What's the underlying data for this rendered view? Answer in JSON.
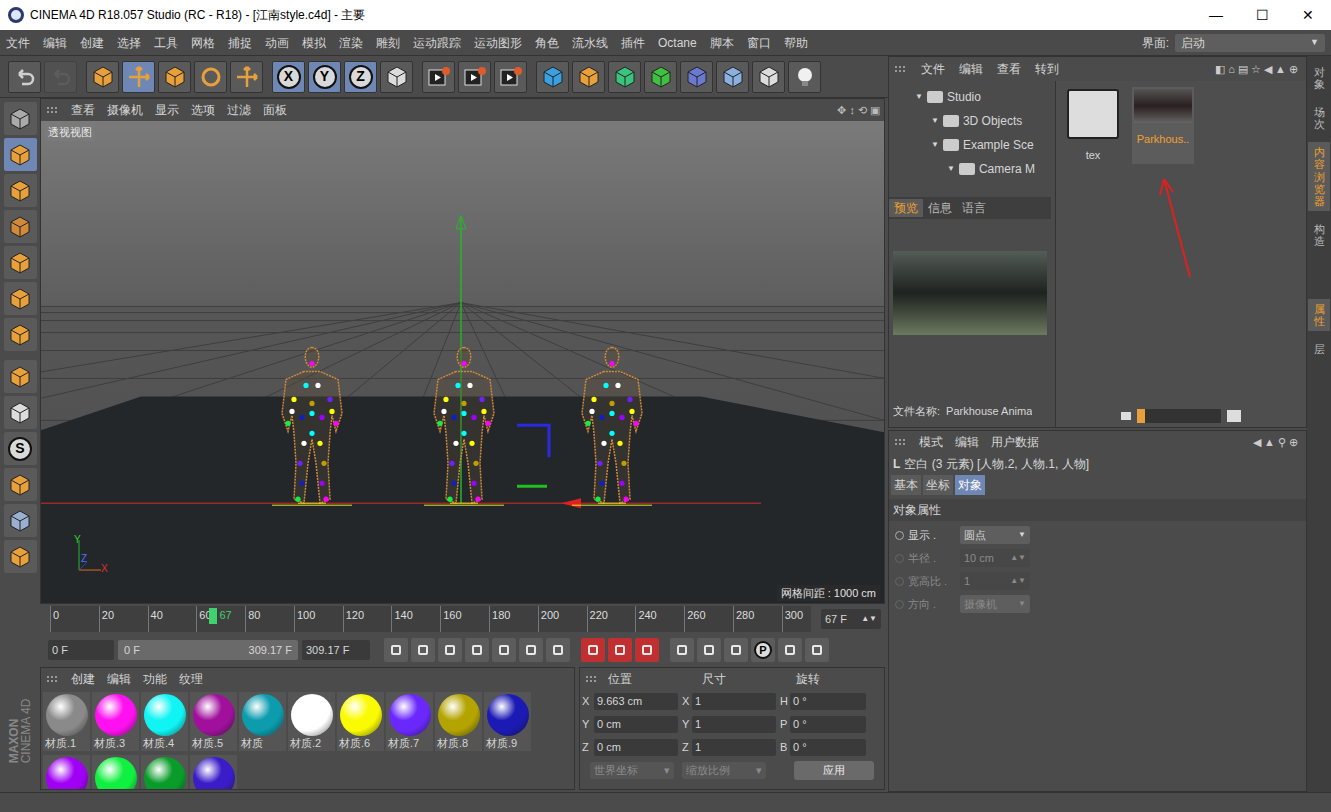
{
  "window": {
    "title": "CINEMA 4D R18.057 Studio (RC - R18) - [江南style.c4d] - 主要",
    "controls": [
      "—",
      "☐",
      "✕"
    ]
  },
  "menu": [
    "文件",
    "编辑",
    "创建",
    "选择",
    "工具",
    "网格",
    "捕捉",
    "动画",
    "模拟",
    "渲染",
    "雕刻",
    "运动跟踪",
    "运动图形",
    "角色",
    "流水线",
    "插件",
    "Octane",
    "脚本",
    "窗口",
    "帮助"
  ],
  "layout": {
    "label": "界面:",
    "value": "启动"
  },
  "toolbar": [
    {
      "kind": "undo",
      "selected": false,
      "disabled": false
    },
    {
      "kind": "redo",
      "selected": false,
      "disabled": true
    },
    {
      "kind": "select",
      "selected": false,
      "disabled": false
    },
    {
      "kind": "move",
      "selected": true,
      "disabled": false
    },
    {
      "kind": "scale",
      "selected": false,
      "disabled": false
    },
    {
      "kind": "rotate",
      "selected": false,
      "disabled": false
    },
    {
      "kind": "add",
      "selected": false,
      "disabled": false
    },
    {
      "kind": "axis",
      "label": "X",
      "selected": true,
      "disabled": false
    },
    {
      "kind": "axis",
      "label": "Y",
      "selected": true,
      "disabled": false
    },
    {
      "kind": "axis",
      "label": "Z",
      "selected": true,
      "disabled": false
    },
    {
      "kind": "coord",
      "selected": false,
      "disabled": false
    },
    {
      "kind": "render",
      "selected": false,
      "disabled": false
    },
    {
      "kind": "render",
      "selected": false,
      "disabled": false
    },
    {
      "kind": "render",
      "selected": false,
      "disabled": false
    },
    {
      "kind": "cube",
      "selected": false,
      "disabled": false
    },
    {
      "kind": "pen",
      "selected": false,
      "disabled": false
    },
    {
      "kind": "subdiv",
      "selected": false,
      "disabled": false
    },
    {
      "kind": "cloner",
      "selected": false,
      "disabled": false
    },
    {
      "kind": "deformer",
      "selected": false,
      "disabled": false
    },
    {
      "kind": "floor",
      "selected": false,
      "disabled": false
    },
    {
      "kind": "camera",
      "selected": false,
      "disabled": false
    },
    {
      "kind": "light",
      "selected": false,
      "disabled": false
    }
  ],
  "left_tools": [
    {
      "kind": "mode",
      "selected": false
    },
    {
      "kind": "model",
      "selected": true
    },
    {
      "kind": "texture",
      "selected": false
    },
    {
      "kind": "workplane",
      "selected": false
    },
    {
      "kind": "points",
      "selected": false
    },
    {
      "kind": "edges",
      "selected": false
    },
    {
      "kind": "polygons",
      "selected": false
    },
    {
      "kind": "axis",
      "selected": false
    },
    {
      "kind": "tweak",
      "selected": false
    },
    {
      "kind": "solo",
      "label": "S",
      "selected": false
    },
    {
      "kind": "magnet",
      "selected": false
    },
    {
      "kind": "lock",
      "selected": false
    },
    {
      "kind": "grid",
      "selected": false
    }
  ],
  "logo": {
    "brand": "MAXON",
    "product": "CINEMA 4D"
  },
  "viewport": {
    "menu": [
      "查看",
      "摄像机",
      "显示",
      "选项",
      "过滤",
      "面板"
    ],
    "label": "透视视图",
    "grid": "网格间距 : 1000 cm",
    "axes": [
      "Y",
      "Z",
      "X"
    ]
  },
  "timeline": {
    "ticks": [
      "0",
      "20",
      "40",
      "60",
      "80",
      "100",
      "120",
      "140",
      "160",
      "180",
      "200",
      "220",
      "240",
      "260",
      "280",
      "300"
    ],
    "current": "67",
    "end": 312,
    "field": "67 F"
  },
  "playback": {
    "start": "0 F",
    "range_start": "0 F",
    "range_end": "309.17 F",
    "end": "309.17 F",
    "buttons": [
      {
        "kind": "first"
      },
      {
        "kind": "prev-key"
      },
      {
        "kind": "prev"
      },
      {
        "kind": "play"
      },
      {
        "kind": "next"
      },
      {
        "kind": "next-key"
      },
      {
        "kind": "last"
      },
      {
        "kind": "record"
      },
      {
        "kind": "autokey"
      },
      {
        "kind": "help"
      },
      {
        "kind": "pos"
      },
      {
        "kind": "scl"
      },
      {
        "kind": "rot"
      },
      {
        "kind": "param",
        "label": "P"
      },
      {
        "kind": "pla"
      },
      {
        "kind": "film"
      }
    ]
  },
  "materials": {
    "menu": [
      "创建",
      "编辑",
      "功能",
      "纹理"
    ],
    "items": [
      {
        "name": "材质.1",
        "color": "#8a8a8a"
      },
      {
        "name": "材质.3",
        "color": "#ff10f0"
      },
      {
        "name": "材质.4",
        "color": "#10f4f4"
      },
      {
        "name": "材质.5",
        "color": "#a0109c"
      },
      {
        "name": "材质",
        "color": "#0c9cae"
      },
      {
        "name": "材质.2",
        "color": "#ffffff"
      },
      {
        "name": "材质.6",
        "color": "#fafa00"
      },
      {
        "name": "材质.7",
        "color": "#6a28ff"
      },
      {
        "name": "材质.8",
        "color": "#b4a400"
      },
      {
        "name": "材质.9",
        "color": "#1c1ab4"
      },
      {
        "name": "",
        "color": "#a000f4"
      },
      {
        "name": "",
        "color": "#10f040"
      },
      {
        "name": "",
        "color": "#0a9c2a"
      },
      {
        "name": "",
        "color": "#3a1cc8"
      }
    ]
  },
  "coordinates": {
    "headers": [
      "位置",
      "尺寸",
      "旋转"
    ],
    "rows": [
      {
        "axis": "X",
        "position": "9.663 cm",
        "size_axis": "X",
        "size": "1",
        "rot_axis": "H",
        "rotation": "0 °"
      },
      {
        "axis": "Y",
        "position": "0 cm",
        "size_axis": "Y",
        "size": "1",
        "rot_axis": "P",
        "rotation": "0 °"
      },
      {
        "axis": "Z",
        "position": "0 cm",
        "size_axis": "Z",
        "size": "1",
        "rot_axis": "B",
        "rotation": "0 °"
      }
    ],
    "mode": "世界坐标",
    "scale": "缩放比例",
    "apply": "应用"
  },
  "content_browser": {
    "menu": [
      "文件",
      "编辑",
      "查看",
      "转到"
    ],
    "tree": [
      {
        "label": "Studio",
        "depth": 0
      },
      {
        "label": "3D Objects",
        "depth": 1
      },
      {
        "label": "Example Sce",
        "depth": 1
      },
      {
        "label": "Camera M",
        "depth": 2
      }
    ],
    "tabs": [
      {
        "label": "预览",
        "selected": true
      },
      {
        "label": "信息",
        "selected": false
      },
      {
        "label": "语言",
        "selected": false
      }
    ],
    "filename_label": "文件名称:",
    "filename": "Parkhouse Anima",
    "items": [
      {
        "label": "tex",
        "kind": "folder",
        "selected": false
      },
      {
        "label": "Parkhous..",
        "kind": "image",
        "selected": true
      }
    ],
    "zoom": 0.1
  },
  "attributes": {
    "menu": [
      "模式",
      "编辑",
      "用户数据"
    ],
    "object": "空白 (3 元素) [人物.2, 人物.1, 人物]",
    "tabs": [
      {
        "label": "基本",
        "selected": false
      },
      {
        "label": "坐标",
        "selected": false
      },
      {
        "label": "对象",
        "selected": true
      }
    ],
    "section": "对象属性",
    "fields": [
      {
        "label": "显示 .",
        "value": "圆点",
        "kind": "dropdown",
        "disabled": false
      },
      {
        "label": "半径 .",
        "value": "10 cm",
        "kind": "number",
        "disabled": true
      },
      {
        "label": "宽高比 .",
        "value": "1",
        "kind": "number",
        "disabled": true
      },
      {
        "label": "方向 .",
        "value": "摄像机",
        "kind": "dropdown",
        "disabled": true
      }
    ]
  },
  "side_tabs": {
    "top": [
      {
        "label": "对象",
        "selected": false
      },
      {
        "label": "场次",
        "selected": false
      },
      {
        "label": "内容浏览器",
        "selected": true
      },
      {
        "label": "构造",
        "selected": false
      }
    ],
    "bottom": [
      {
        "label": "属性",
        "selected": true
      },
      {
        "label": "层",
        "selected": false
      }
    ]
  }
}
